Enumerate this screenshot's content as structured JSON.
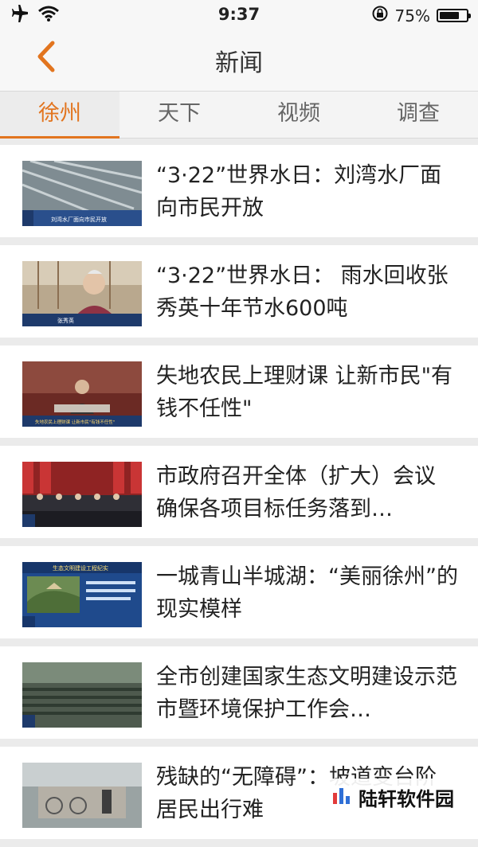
{
  "status_bar": {
    "time": "9:37",
    "battery": "75%",
    "battery_level": 0.75
  },
  "nav": {
    "title": "新闻"
  },
  "tabs": [
    {
      "label": "徐州",
      "active": true
    },
    {
      "label": "天下",
      "active": false
    },
    {
      "label": "视频",
      "active": false
    },
    {
      "label": "调查",
      "active": false
    }
  ],
  "news": [
    {
      "headline": "“3·22”世界水日：刘湾水厂面向市民开放",
      "thumb_caption": "刘湾水厂面向市民开放"
    },
    {
      "headline": "“3·22”世界水日： 雨水回收张秀英十年节水600吨",
      "thumb_caption": "张秀英"
    },
    {
      "headline": "失地农民上理财课 让新市民\"有钱不任性\"",
      "thumb_caption": "失地农民上理财课 让新市民\"有钱不任性\""
    },
    {
      "headline": "市政府召开全体（扩大）会议 确保各项目标任务落到…",
      "thumb_caption": ""
    },
    {
      "headline": "一城青山半城湖：“美丽徐州”的现实模样",
      "thumb_caption": "生态文明建设工程纪实"
    },
    {
      "headline": "全市创建国家生态文明建设示范市暨环境保护工作会…",
      "thumb_caption": ""
    },
    {
      "headline": "残缺的“无障碍”：坡道变台阶 居民出行难",
      "thumb_caption": ""
    }
  ],
  "watermark": {
    "text": "陆轩软件园"
  },
  "colors": {
    "accent": "#e2751f",
    "background": "#ebebeb"
  }
}
